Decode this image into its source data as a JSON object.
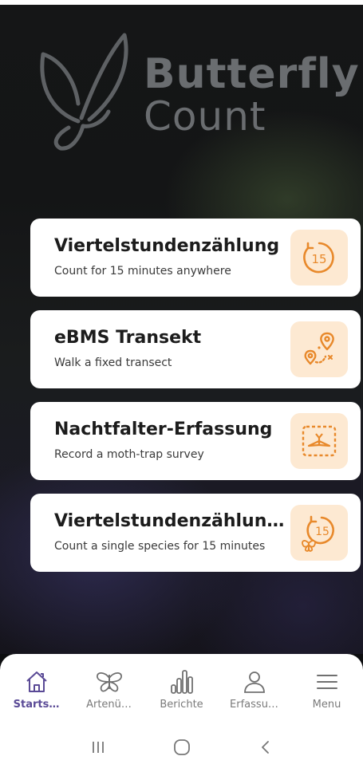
{
  "app": {
    "logo_line1": "Butterfly",
    "logo_line2": "Count"
  },
  "cards": [
    {
      "title": "Viertelstundenzählung",
      "subtitle": "Count for 15 minutes anywhere",
      "icon": "timer-15-icon",
      "icon_text": "15"
    },
    {
      "title": "eBMS Transekt",
      "subtitle": "Walk a fixed transect",
      "icon": "route-pin-icon"
    },
    {
      "title": "Nachtfalter-Erfassung",
      "subtitle": "Record a moth-trap survey",
      "icon": "moth-trap-icon"
    },
    {
      "title": "Viertelstundenzählung…",
      "subtitle": "Count a single species for 15 minutes",
      "icon": "timer-15-butterfly-icon",
      "icon_text": "15"
    }
  ],
  "nav": [
    {
      "label": "Starts…",
      "icon": "home-icon",
      "active": true
    },
    {
      "label": "Artenü…",
      "icon": "butterfly-icon",
      "active": false
    },
    {
      "label": "Berichte",
      "icon": "bar-chart-icon",
      "active": false
    },
    {
      "label": "Erfassu…",
      "icon": "person-icon",
      "active": false
    },
    {
      "label": "Menu",
      "icon": "hamburger-icon",
      "active": false
    }
  ],
  "colors": {
    "accent": "#5a4a96",
    "icon_orange": "#e8892b",
    "icon_bg": "#fde9d2"
  }
}
